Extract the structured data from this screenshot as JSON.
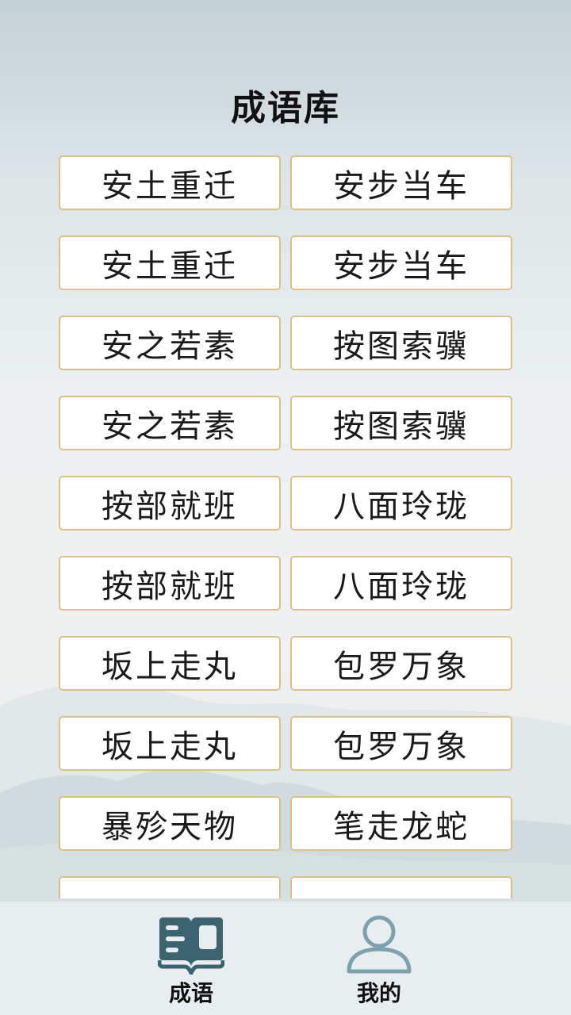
{
  "header": {
    "title": "成语库"
  },
  "idioms": [
    [
      "安土重迁",
      "安步当车"
    ],
    [
      "安土重迁",
      "安步当车"
    ],
    [
      "安之若素",
      "按图索骥"
    ],
    [
      "安之若素",
      "按图索骥"
    ],
    [
      "按部就班",
      "八面玲珑"
    ],
    [
      "按部就班",
      "八面玲珑"
    ],
    [
      "坂上走丸",
      "包罗万象"
    ],
    [
      "坂上走丸",
      "包罗万象"
    ],
    [
      "暴殄天物",
      "笔走龙蛇"
    ],
    [
      "",
      ""
    ]
  ],
  "tabbar": {
    "tabs": [
      {
        "label": "成语",
        "icon": "book-icon",
        "active": true
      },
      {
        "label": "我的",
        "icon": "user-icon",
        "active": false
      }
    ]
  },
  "colors": {
    "card_border": "#d9c08d",
    "icon_active": "#3b6470",
    "icon_inactive": "#7da1ad"
  }
}
